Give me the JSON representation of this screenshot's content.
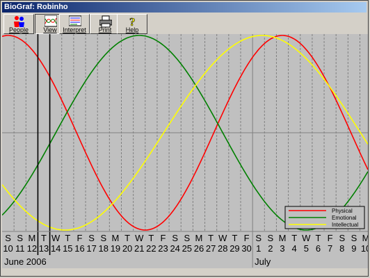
{
  "window": {
    "title": "BioGraf: Robinho"
  },
  "toolbar": {
    "buttons": [
      {
        "label": "People",
        "icon": "people-icon"
      },
      {
        "label": "View",
        "icon": "view-icon"
      },
      {
        "label": "Interpret",
        "icon": "interpret-icon"
      },
      {
        "label": "Print",
        "icon": "print-icon"
      },
      {
        "label": "Help",
        "icon": "help-icon"
      }
    ]
  },
  "colors": {
    "background": "#c0c0c0",
    "physical": "#ff0000",
    "emotional": "#008000",
    "intellectual": "#ffff00",
    "selection": "#000000"
  },
  "chart_data": {
    "type": "line",
    "x_start_day": 10,
    "days": [
      {
        "dow": "S",
        "date": "10"
      },
      {
        "dow": "S",
        "date": "11"
      },
      {
        "dow": "M",
        "date": "12"
      },
      {
        "dow": "T",
        "date": "13"
      },
      {
        "dow": "W",
        "date": "14"
      },
      {
        "dow": "T",
        "date": "15"
      },
      {
        "dow": "F",
        "date": "16"
      },
      {
        "dow": "S",
        "date": "17"
      },
      {
        "dow": "S",
        "date": "18"
      },
      {
        "dow": "M",
        "date": "19"
      },
      {
        "dow": "T",
        "date": "20"
      },
      {
        "dow": "W",
        "date": "21"
      },
      {
        "dow": "T",
        "date": "22"
      },
      {
        "dow": "F",
        "date": "23"
      },
      {
        "dow": "S",
        "date": "24"
      },
      {
        "dow": "S",
        "date": "25"
      },
      {
        "dow": "M",
        "date": "26"
      },
      {
        "dow": "T",
        "date": "27"
      },
      {
        "dow": "W",
        "date": "28"
      },
      {
        "dow": "T",
        "date": "29"
      },
      {
        "dow": "F",
        "date": "30"
      },
      {
        "dow": "S",
        "date": "1"
      },
      {
        "dow": "S",
        "date": "2"
      },
      {
        "dow": "M",
        "date": "3"
      },
      {
        "dow": "T",
        "date": "4"
      },
      {
        "dow": "W",
        "date": "5"
      },
      {
        "dow": "T",
        "date": "6"
      },
      {
        "dow": "F",
        "date": "7"
      },
      {
        "dow": "S",
        "date": "8"
      },
      {
        "dow": "S",
        "date": "9"
      },
      {
        "dow": "M",
        "date": "10"
      }
    ],
    "months": [
      {
        "label": "June 2006",
        "start_index": 0
      },
      {
        "label": "July",
        "start_index": 21
      }
    ],
    "selected_day_index": 3,
    "ylim": [
      -1,
      1
    ],
    "series": [
      {
        "name": "Physical",
        "color": "#ff0000",
        "period": 23,
        "peak_index": 23.5
      },
      {
        "name": "Emotional",
        "color": "#008000",
        "period": 28,
        "peak_index": 11.5
      },
      {
        "name": "Intellectual",
        "color": "#ffff00",
        "period": 33,
        "peak_index": 21.8
      }
    ],
    "legend_position": "bottom-right",
    "grid": true
  }
}
